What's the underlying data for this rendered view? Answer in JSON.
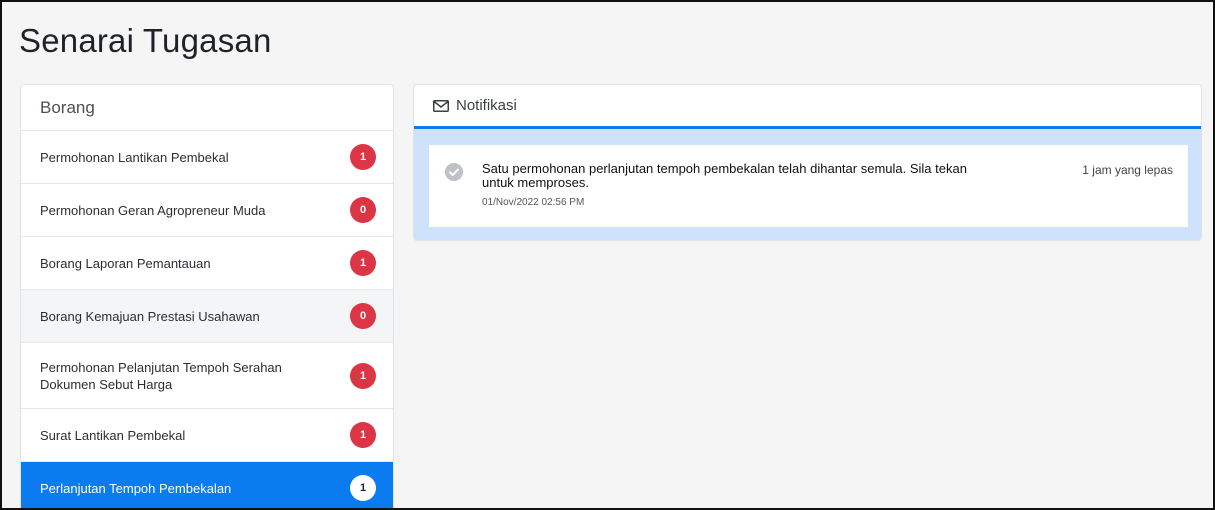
{
  "page": {
    "title": "Senarai Tugasan"
  },
  "forms": {
    "header": "Borang",
    "items": [
      {
        "label": "Permohonan Lantikan Pembekal",
        "count": "1"
      },
      {
        "label": "Permohonan Geran Agropreneur Muda",
        "count": "0"
      },
      {
        "label": "Borang Laporan Pemantauan",
        "count": "1"
      },
      {
        "label": "Borang Kemajuan Prestasi Usahawan",
        "count": "0"
      },
      {
        "label": "Permohonan Pelanjutan Tempoh Serahan Dokumen Sebut Harga",
        "count": "1"
      },
      {
        "label": "Surat Lantikan Pembekal",
        "count": "1"
      },
      {
        "label": "Perlanjutan Tempoh Pembekalan",
        "count": "1"
      }
    ]
  },
  "notifications": {
    "header": "Notifikasi",
    "items": [
      {
        "message": "Satu permohonan perlanjutan tempoh pembekalan telah dihantar semula. Sila tekan untuk memproses.",
        "date": "01/Nov/2022 02:56 PM",
        "time_ago": "1 jam yang lepas",
        "icon": "check-circle-icon"
      }
    ]
  },
  "colors": {
    "accent": "#0a7cf0",
    "badge": "#dc3545",
    "notif_panel": "#cfe2fb"
  }
}
